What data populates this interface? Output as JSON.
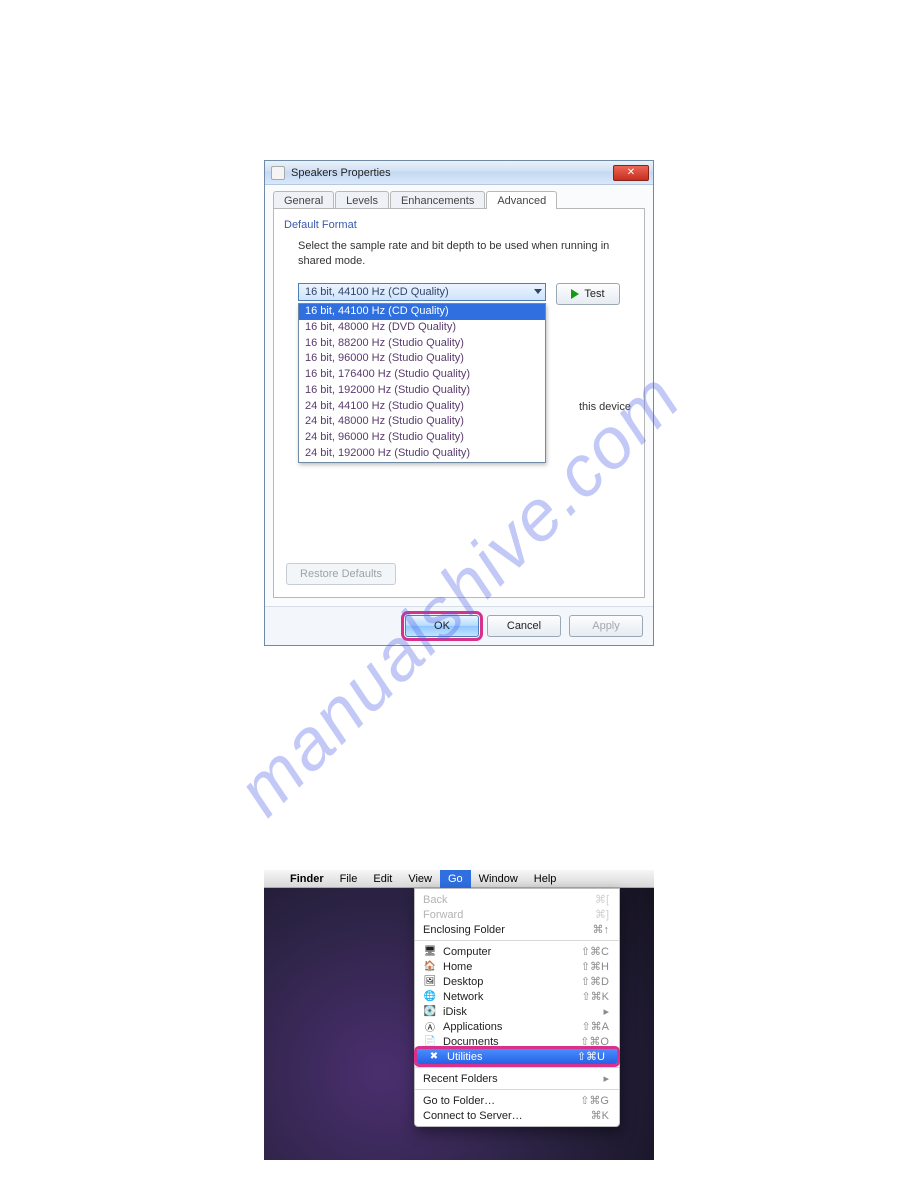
{
  "watermark": "manualshive.com",
  "win_dialog": {
    "title": "Speakers Properties",
    "close_glyph": "✕",
    "tabs": [
      {
        "label": "General"
      },
      {
        "label": "Levels"
      },
      {
        "label": "Enhancements"
      },
      {
        "label": "Advanced"
      }
    ],
    "default_format_label": "Default Format",
    "default_format_desc": "Select the sample rate and bit depth to be used when running in shared mode.",
    "combo_selected": "16 bit, 44100 Hz (CD Quality)",
    "test_label": "Test",
    "peek_text": "this device",
    "options": [
      "16 bit, 44100 Hz (CD Quality)",
      "16 bit, 48000 Hz (DVD Quality)",
      "16 bit, 88200 Hz (Studio Quality)",
      "16 bit, 96000 Hz (Studio Quality)",
      "16 bit, 176400 Hz (Studio Quality)",
      "16 bit, 192000 Hz (Studio Quality)",
      "24 bit, 44100 Hz (Studio Quality)",
      "24 bit, 48000 Hz (Studio Quality)",
      "24 bit, 96000 Hz (Studio Quality)",
      "24 bit, 192000 Hz (Studio Quality)"
    ],
    "restore_label": "Restore Defaults",
    "ok_label": "OK",
    "cancel_label": "Cancel",
    "apply_label": "Apply"
  },
  "mac": {
    "menubar": {
      "finder": "Finder",
      "file": "File",
      "edit": "Edit",
      "view": "View",
      "go": "Go",
      "window": "Window",
      "help": "Help"
    },
    "menu": {
      "back": {
        "label": "Back",
        "cut": "⌘["
      },
      "forward": {
        "label": "Forward",
        "cut": "⌘]"
      },
      "enclosing": {
        "label": "Enclosing Folder",
        "cut": "⌘↑"
      },
      "computer": {
        "label": "Computer",
        "cut": "⇧⌘C"
      },
      "home": {
        "label": "Home",
        "cut": "⇧⌘H"
      },
      "desktop": {
        "label": "Desktop",
        "cut": "⇧⌘D"
      },
      "network": {
        "label": "Network",
        "cut": "⇧⌘K"
      },
      "idisk": {
        "label": "iDisk",
        "cut": "▸"
      },
      "applications": {
        "label": "Applications",
        "cut": "⇧⌘A"
      },
      "documents": {
        "label": "Documents",
        "cut": "⇧⌘O"
      },
      "utilities": {
        "label": "Utilities",
        "cut": "⇧⌘U"
      },
      "recent": {
        "label": "Recent Folders",
        "cut": "▸"
      },
      "gotofolder": {
        "label": "Go to Folder…",
        "cut": "⇧⌘G"
      },
      "connect": {
        "label": "Connect to Server…",
        "cut": "⌘K"
      }
    }
  }
}
